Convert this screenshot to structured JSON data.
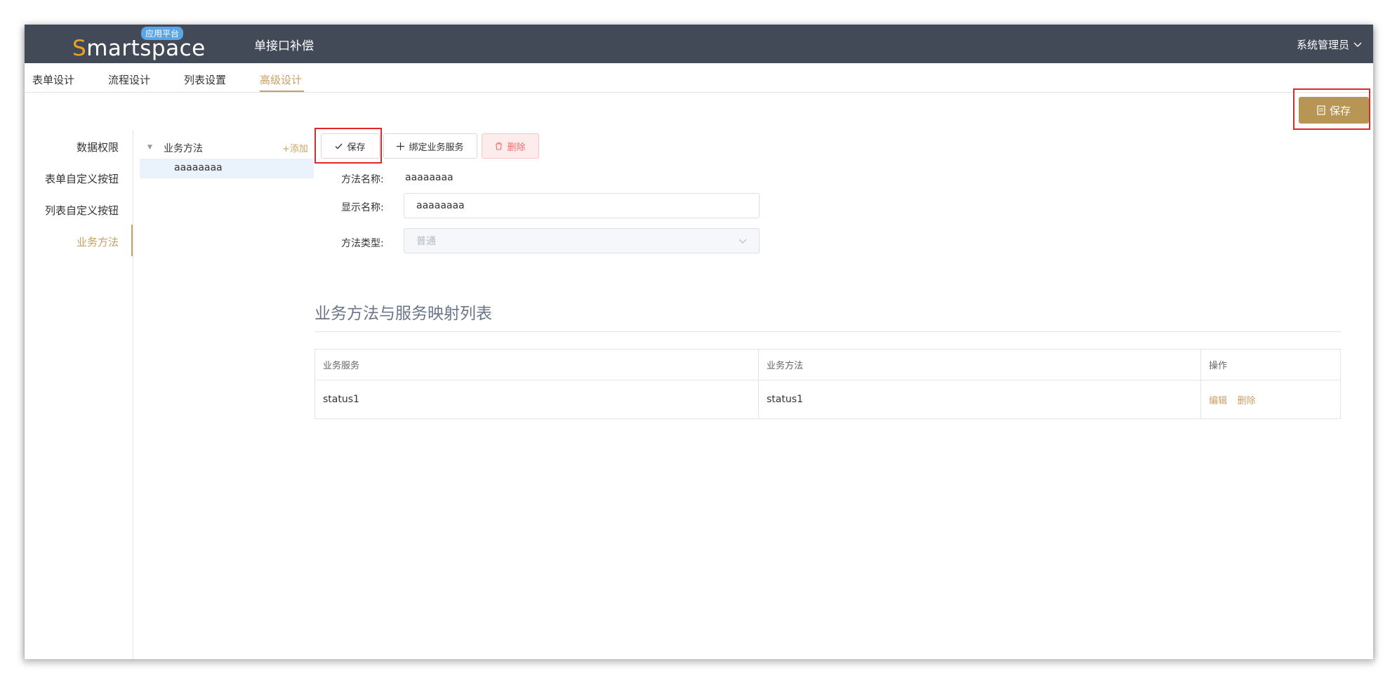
{
  "header": {
    "logo_text_s": "S",
    "logo_text_rest": "martspace",
    "logo_badge": "应用平台",
    "app_title": "单接口补偿",
    "user_name": "系统管理员"
  },
  "tabs": [
    {
      "label": "表单设计"
    },
    {
      "label": "流程设计"
    },
    {
      "label": "列表设置"
    },
    {
      "label": "高级设计"
    }
  ],
  "top_save_label": "保存",
  "side_nav": [
    {
      "label": "数据权限"
    },
    {
      "label": "表单自定义按钮"
    },
    {
      "label": "列表自定义按钮"
    },
    {
      "label": "业务方法"
    }
  ],
  "tree": {
    "root_label": "业务方法",
    "add_label": "+添加",
    "child_label": "aaaaaaaa"
  },
  "toolbar": {
    "save_label": "保存",
    "bind_label": "绑定业务服务",
    "delete_label": "删除"
  },
  "form": {
    "method_name_label": "方法名称:",
    "method_name_value": "aaaaaaaa",
    "display_name_label": "显示名称:",
    "display_name_value": "aaaaaaaa",
    "method_type_label": "方法类型:",
    "method_type_value": "普通"
  },
  "mapping": {
    "title": "业务方法与服务映射列表",
    "columns": [
      "业务服务",
      "业务方法",
      "操作"
    ],
    "rows": [
      {
        "service": "status1",
        "method": "status1",
        "edit": "编辑",
        "delete": "删除"
      }
    ]
  },
  "colors": {
    "accent": "#c9a062",
    "topbar": "#434a57",
    "highlight_box": "#e4262b"
  }
}
